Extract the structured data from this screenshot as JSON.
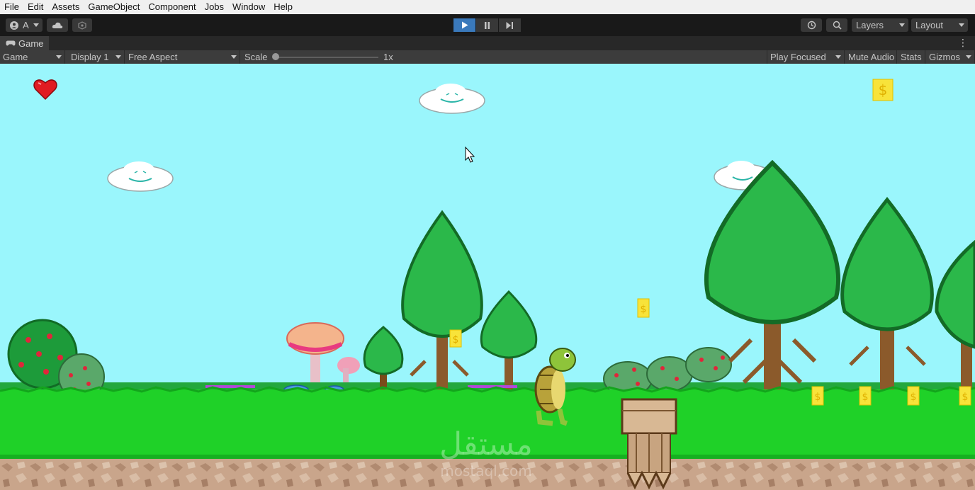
{
  "menu": [
    "File",
    "Edit",
    "Assets",
    "GameObject",
    "Component",
    "Jobs",
    "Window",
    "Help"
  ],
  "toolbar": {
    "account_label": "A",
    "layers_label": "Layers",
    "layout_label": "Layout"
  },
  "tab": {
    "title": "Game"
  },
  "gamebar": {
    "view_mode": "Game",
    "display": "Display 1",
    "aspect": "Free Aspect",
    "scale_label": "Scale",
    "scale_value": "1x",
    "play_focused": "Play Focused",
    "mute_audio": "Mute Audio",
    "stats": "Stats",
    "gizmos": "Gizmos"
  },
  "game": {
    "lives": 1,
    "coin_hud_icon": "dollar-coin-icon",
    "coin_count": "",
    "watermark": "مستقل",
    "watermark_sub": "mostaql.com"
  },
  "colors": {
    "sky": "#9af6fc",
    "grass": "#1fd128",
    "dirt": "#c8a98d",
    "play_active": "#3a79bb"
  }
}
